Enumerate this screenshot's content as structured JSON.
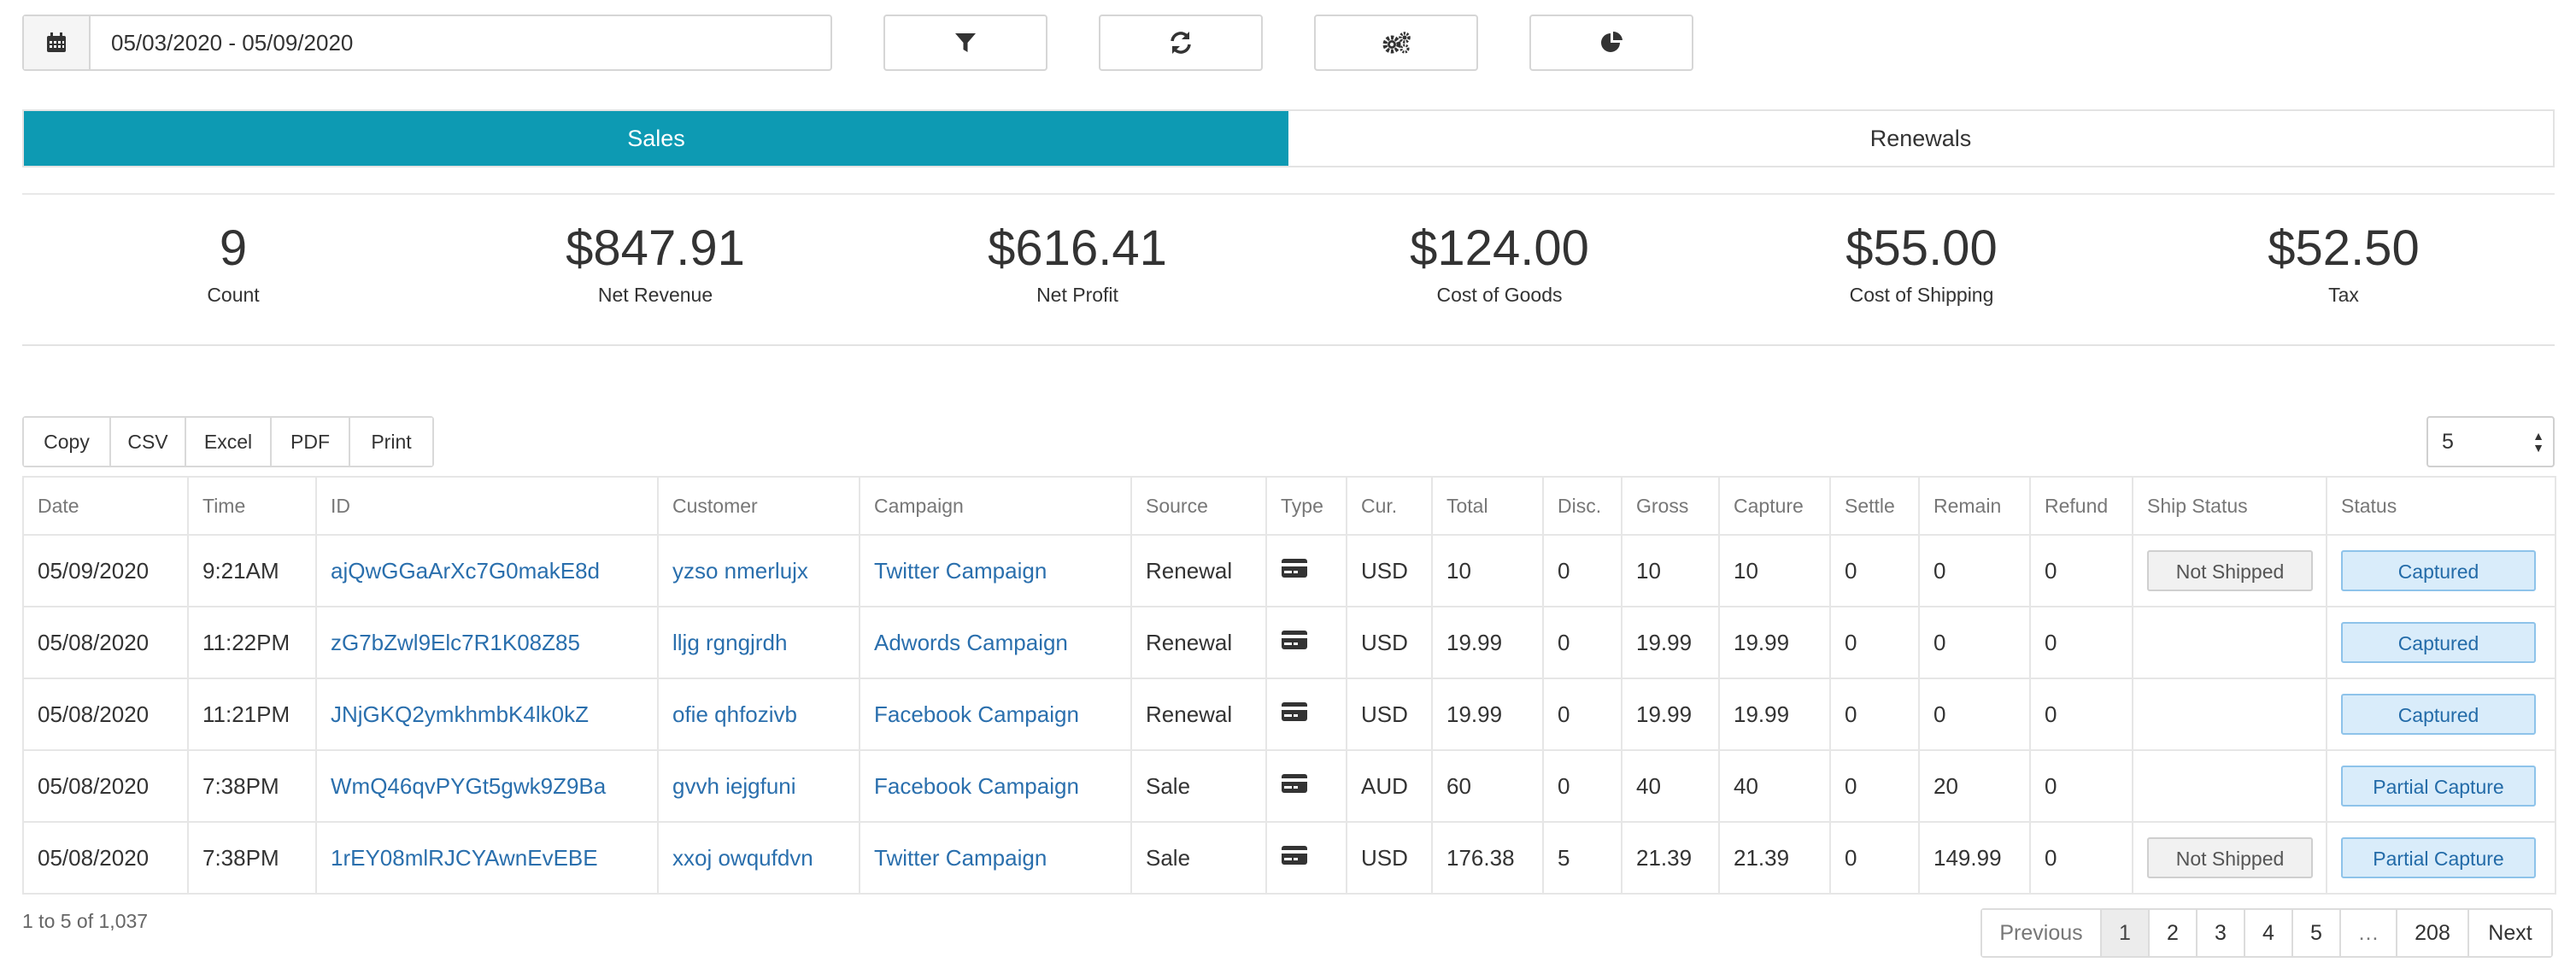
{
  "toolbar": {
    "date_range": "05/03/2020 - 05/09/2020",
    "buttons": [
      {
        "name": "filter-button",
        "icon": "filter-icon"
      },
      {
        "name": "refresh-button",
        "icon": "refresh-icon"
      },
      {
        "name": "settings-button",
        "icon": "gears-icon"
      },
      {
        "name": "chart-button",
        "icon": "pie-chart-icon"
      }
    ]
  },
  "tabs": [
    {
      "label": "Sales",
      "active": true
    },
    {
      "label": "Renewals",
      "active": false
    }
  ],
  "stats": [
    {
      "value": "9",
      "label": "Count"
    },
    {
      "value": "$847.91",
      "label": "Net Revenue"
    },
    {
      "value": "$616.41",
      "label": "Net Profit"
    },
    {
      "value": "$124.00",
      "label": "Cost of Goods"
    },
    {
      "value": "$55.00",
      "label": "Cost of Shipping"
    },
    {
      "value": "$52.50",
      "label": "Tax"
    }
  ],
  "export_buttons": [
    "Copy",
    "CSV",
    "Excel",
    "PDF",
    "Print"
  ],
  "page_size": "5",
  "table": {
    "columns": [
      "Date",
      "Time",
      "ID",
      "Customer",
      "Campaign",
      "Source",
      "Type",
      "Cur.",
      "Total",
      "Disc.",
      "Gross",
      "Capture",
      "Settle",
      "Remain",
      "Refund",
      "Ship Status",
      "Status"
    ],
    "rows": [
      {
        "date": "05/09/2020",
        "time": "9:21AM",
        "id": "ajQwGGaArXc7G0makE8d",
        "customer": "yzso nmerlujx",
        "campaign": "Twitter Campaign",
        "source": "Renewal",
        "type_icon": "credit-card-icon",
        "cur": "USD",
        "total": "10",
        "disc": "0",
        "gross": "10",
        "capture": "10",
        "settle": "0",
        "remain": "0",
        "refund": "0",
        "ship_status": "Not Shipped",
        "status": "Captured"
      },
      {
        "date": "05/08/2020",
        "time": "11:22PM",
        "id": "zG7bZwl9Elc7R1K08Z85",
        "customer": "lljg rgngjrdh",
        "campaign": "Adwords Campaign",
        "source": "Renewal",
        "type_icon": "credit-card-icon",
        "cur": "USD",
        "total": "19.99",
        "disc": "0",
        "gross": "19.99",
        "capture": "19.99",
        "settle": "0",
        "remain": "0",
        "refund": "0",
        "ship_status": "",
        "status": "Captured"
      },
      {
        "date": "05/08/2020",
        "time": "11:21PM",
        "id": "JNjGKQ2ymkhmbK4lk0kZ",
        "customer": "ofie qhfozivb",
        "campaign": "Facebook Campaign",
        "source": "Renewal",
        "type_icon": "credit-card-icon",
        "cur": "USD",
        "total": "19.99",
        "disc": "0",
        "gross": "19.99",
        "capture": "19.99",
        "settle": "0",
        "remain": "0",
        "refund": "0",
        "ship_status": "",
        "status": "Captured"
      },
      {
        "date": "05/08/2020",
        "time": "7:38PM",
        "id": "WmQ46qvPYGt5gwk9Z9Ba",
        "customer": "gvvh iejgfuni",
        "campaign": "Facebook Campaign",
        "source": "Sale",
        "type_icon": "credit-card-icon",
        "cur": "AUD",
        "total": "60",
        "disc": "0",
        "gross": "40",
        "capture": "40",
        "settle": "0",
        "remain": "20",
        "refund": "0",
        "ship_status": "",
        "status": "Partial Capture"
      },
      {
        "date": "05/08/2020",
        "time": "7:38PM",
        "id": "1rEY08mlRJCYAwnEvEBE",
        "customer": "xxoj owqufdvn",
        "campaign": "Twitter Campaign",
        "source": "Sale",
        "type_icon": "credit-card-icon",
        "cur": "USD",
        "total": "176.38",
        "disc": "5",
        "gross": "21.39",
        "capture": "21.39",
        "settle": "0",
        "remain": "149.99",
        "refund": "0",
        "ship_status": "Not Shipped",
        "status": "Partial Capture"
      }
    ]
  },
  "footer": {
    "info": "1 to 5 of 1,037",
    "pagination": [
      "Previous",
      "1",
      "2",
      "3",
      "4",
      "5",
      "…",
      "208",
      "Next"
    ],
    "current_page": "1"
  },
  "colors": {
    "accent": "#0d9ab3",
    "link": "#2a6fad",
    "status_badge_bg": "#d9ecfa",
    "ship_badge_bg": "#f1f1f1"
  }
}
